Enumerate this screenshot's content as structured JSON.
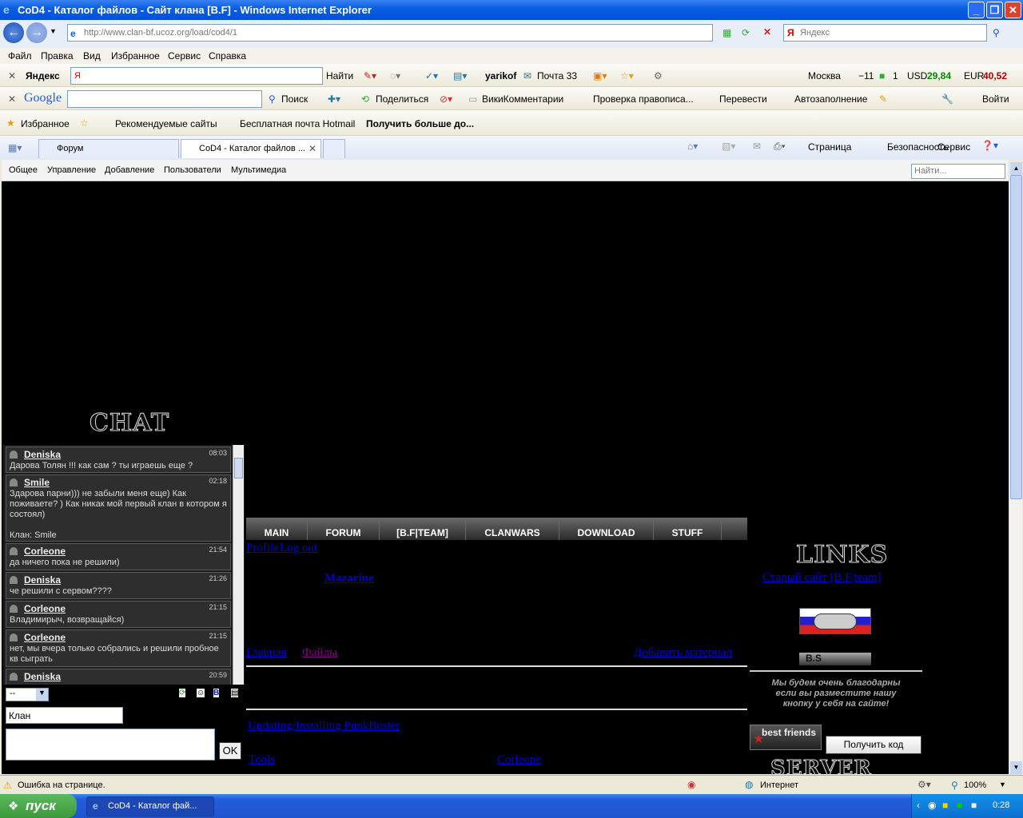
{
  "window": {
    "title": "CoD4 - Каталог файлов - Сайт клана [B.F] - Windows Internet Explorer"
  },
  "address": {
    "url": "http://www.clan-bf.ucoz.org/load/cod4/1",
    "search_placeholder": "Яндекс"
  },
  "menu": [
    "Файл",
    "Правка",
    "Вид",
    "Избранное",
    "Сервис",
    "Справка"
  ],
  "yandex_bar": {
    "brand": "Яндекс",
    "find": "Найти",
    "user": "yarikof",
    "mail": "Почта 33",
    "city": "Москва",
    "temp": "−11",
    "jams": "1",
    "usd_label": "USD",
    "usd": "29,84",
    "eur_label": "EUR",
    "eur": "40,52"
  },
  "google_bar": {
    "brand": "Google",
    "search": "Поиск",
    "share": "Поделиться",
    "wiki": "ВикиКомментарии",
    "spell": "Проверка правописа...",
    "translate": "Перевести",
    "autofill": "Автозаполнение",
    "signin": "Войти"
  },
  "favorites_bar": {
    "favorites": "Избранное",
    "suggested": "Рекомендуемые сайты",
    "hotmail": "Бесплатная почта Hotmail",
    "more": "Получить больше до..."
  },
  "tabs": [
    {
      "label": "Форум"
    },
    {
      "label": "CoD4 - Каталог файлов ..."
    }
  ],
  "command_bar": {
    "page": "Страница",
    "safety": "Безопасность",
    "tools": "Сервис"
  },
  "site_menu": {
    "items": [
      "Общее",
      "Управление",
      "Добавление",
      "Пользователи",
      "Мультимедиа"
    ],
    "search_placeholder": "Найти..."
  },
  "chat": {
    "heading": "CHAT",
    "messages": [
      {
        "user": "Deniska",
        "time": "08:03",
        "text": "Дарова Толян !!! как сам ? ты играешь еще ?"
      },
      {
        "user": "Smile",
        "time": "02:18",
        "text": "Здарова парни))) не забыли меня еще) Как поживаете? ) Как никак мой первый клан в котором я состоял)\n\nКлан: Smile"
      },
      {
        "user": "Corleone",
        "time": "21:54",
        "text": "да ничего пока не решили)"
      },
      {
        "user": "Deniska",
        "time": "21:26",
        "text": "че решили с сервом????"
      },
      {
        "user": "Corleone",
        "time": "21:15",
        "text": "Владимирыч, возвращайся)"
      },
      {
        "user": "Corleone",
        "time": "21:15",
        "text": "нет, мы вчера только собрались и решили пробное кв сыграть"
      },
      {
        "user": "Deniska",
        "time": "20:59",
        "text": ""
      }
    ],
    "select_value": "--",
    "name_value": "Клан",
    "ok": "OK"
  },
  "nav": [
    "MAIN",
    "FORUM",
    "[B.F|TEAM]",
    "CLANWARS",
    "DOWNLOAD",
    "STUFF"
  ],
  "user_links": {
    "profile": "Profile",
    "logout": "Log out",
    "username": "Mazarine"
  },
  "breadcrumbs": {
    "home": "Главная",
    "files": "Файлы",
    "add": "Добавить материал"
  },
  "entry": {
    "title": "Updating/Installing PunkBuster",
    "category": "Tools",
    "author": "Corleone"
  },
  "links": {
    "heading": "LINKS",
    "old_site": "Старый сайт [B.F|team]",
    "banner2_text": "B.S",
    "note": "Мы будем очень благодарны если вы разместите нашу кнопку у себя на сайте!",
    "best_friends": "best friends",
    "get_code": "Получить код",
    "server": "SERVER"
  },
  "status": {
    "error": "Ошибка на странице.",
    "zone": "Интернет",
    "zoom": "100%"
  },
  "taskbar": {
    "start": "пуск",
    "task": "CoD4 - Каталог фай...",
    "clock": "0:28"
  }
}
